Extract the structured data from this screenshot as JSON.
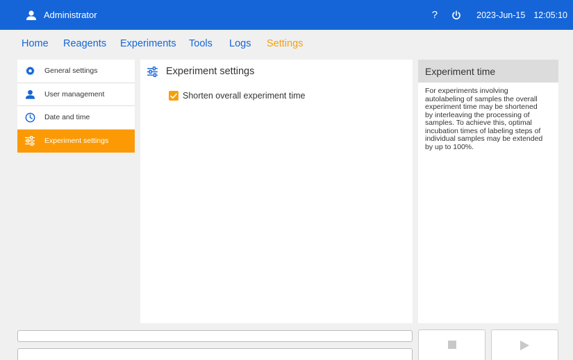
{
  "header": {
    "user_name": "Administrator",
    "help_label": "?",
    "date": "2023-Jun-15",
    "time": "12:05:10",
    "brand_color": "#1565d8"
  },
  "nav": {
    "tabs": [
      {
        "label": "Home"
      },
      {
        "label": "Reagents"
      },
      {
        "label": "Experiments"
      },
      {
        "label": "Tools"
      },
      {
        "label": "Logs"
      },
      {
        "label": "Settings"
      }
    ],
    "active_tab": "Settings",
    "active_color": "#f5a00b"
  },
  "sidebar": {
    "items": [
      {
        "label": "General settings",
        "icon": "gear-icon"
      },
      {
        "label": "User management",
        "icon": "user-icon"
      },
      {
        "label": "Date and time",
        "icon": "clock-icon"
      },
      {
        "label": "Experiment settings",
        "icon": "sliders-icon"
      }
    ],
    "active_index": 3
  },
  "main": {
    "title": "Experiment settings",
    "option": {
      "label": "Shorten overall experiment time",
      "checked": true
    }
  },
  "info": {
    "title": "Experiment time",
    "lines": [
      "For experiments involving",
      "autolabeling of samples the overall",
      "experiment time may be shortened",
      "by interleaving the processing of",
      "samples. To achieve this, optimal",
      "incubation times of labeling steps of",
      "individual samples may be extended",
      "by up to 100%."
    ]
  },
  "controls": {
    "stop_icon": "stop-icon",
    "play_icon": "play-icon"
  }
}
